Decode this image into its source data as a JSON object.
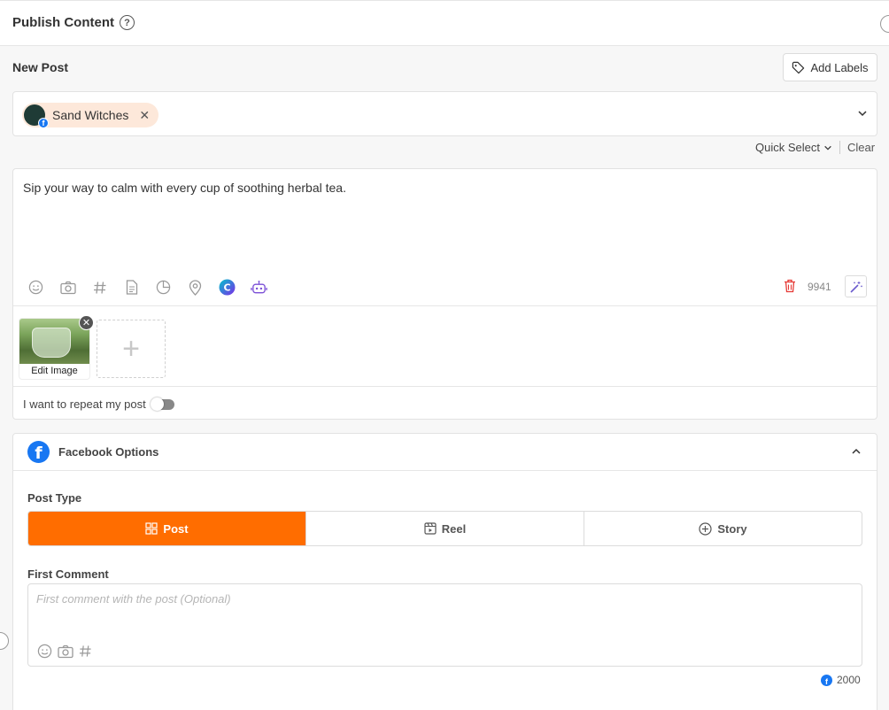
{
  "header": {
    "title": "Publish Content",
    "help_icon": "?"
  },
  "composer": {
    "heading": "New Post",
    "add_labels": "Add Labels",
    "account_chip": {
      "name": "Sand Witches",
      "network": "facebook",
      "remove": "✕"
    },
    "quick_select": "Quick Select",
    "clear": "Clear",
    "text": "Sip your way to calm with every cup of soothing herbal tea.",
    "toolbar_icons": [
      "emoji-icon",
      "camera-icon",
      "hashtag-icon",
      "document-icon",
      "pie-chart-icon",
      "location-icon",
      "canva-icon",
      "ai-bot-icon"
    ],
    "char_count": "9941",
    "media": [
      {
        "label": "Edit Image"
      }
    ],
    "add_media": "+",
    "repeat_label": "I want to repeat my post",
    "repeat_enabled": false
  },
  "facebook_options": {
    "title": "Facebook Options",
    "post_type_label": "Post Type",
    "post_types": [
      {
        "label": "Post",
        "active": true
      },
      {
        "label": "Reel",
        "active": false
      },
      {
        "label": "Story",
        "active": false
      }
    ],
    "first_comment_label": "First Comment",
    "first_comment_placeholder": "First comment with the post (Optional)",
    "first_comment_value": "",
    "first_comment_count": "2000"
  },
  "colors": {
    "accent": "#ff6d00",
    "facebook": "#1877f2",
    "chip_bg": "#fde8da",
    "trash": "#e53935"
  }
}
